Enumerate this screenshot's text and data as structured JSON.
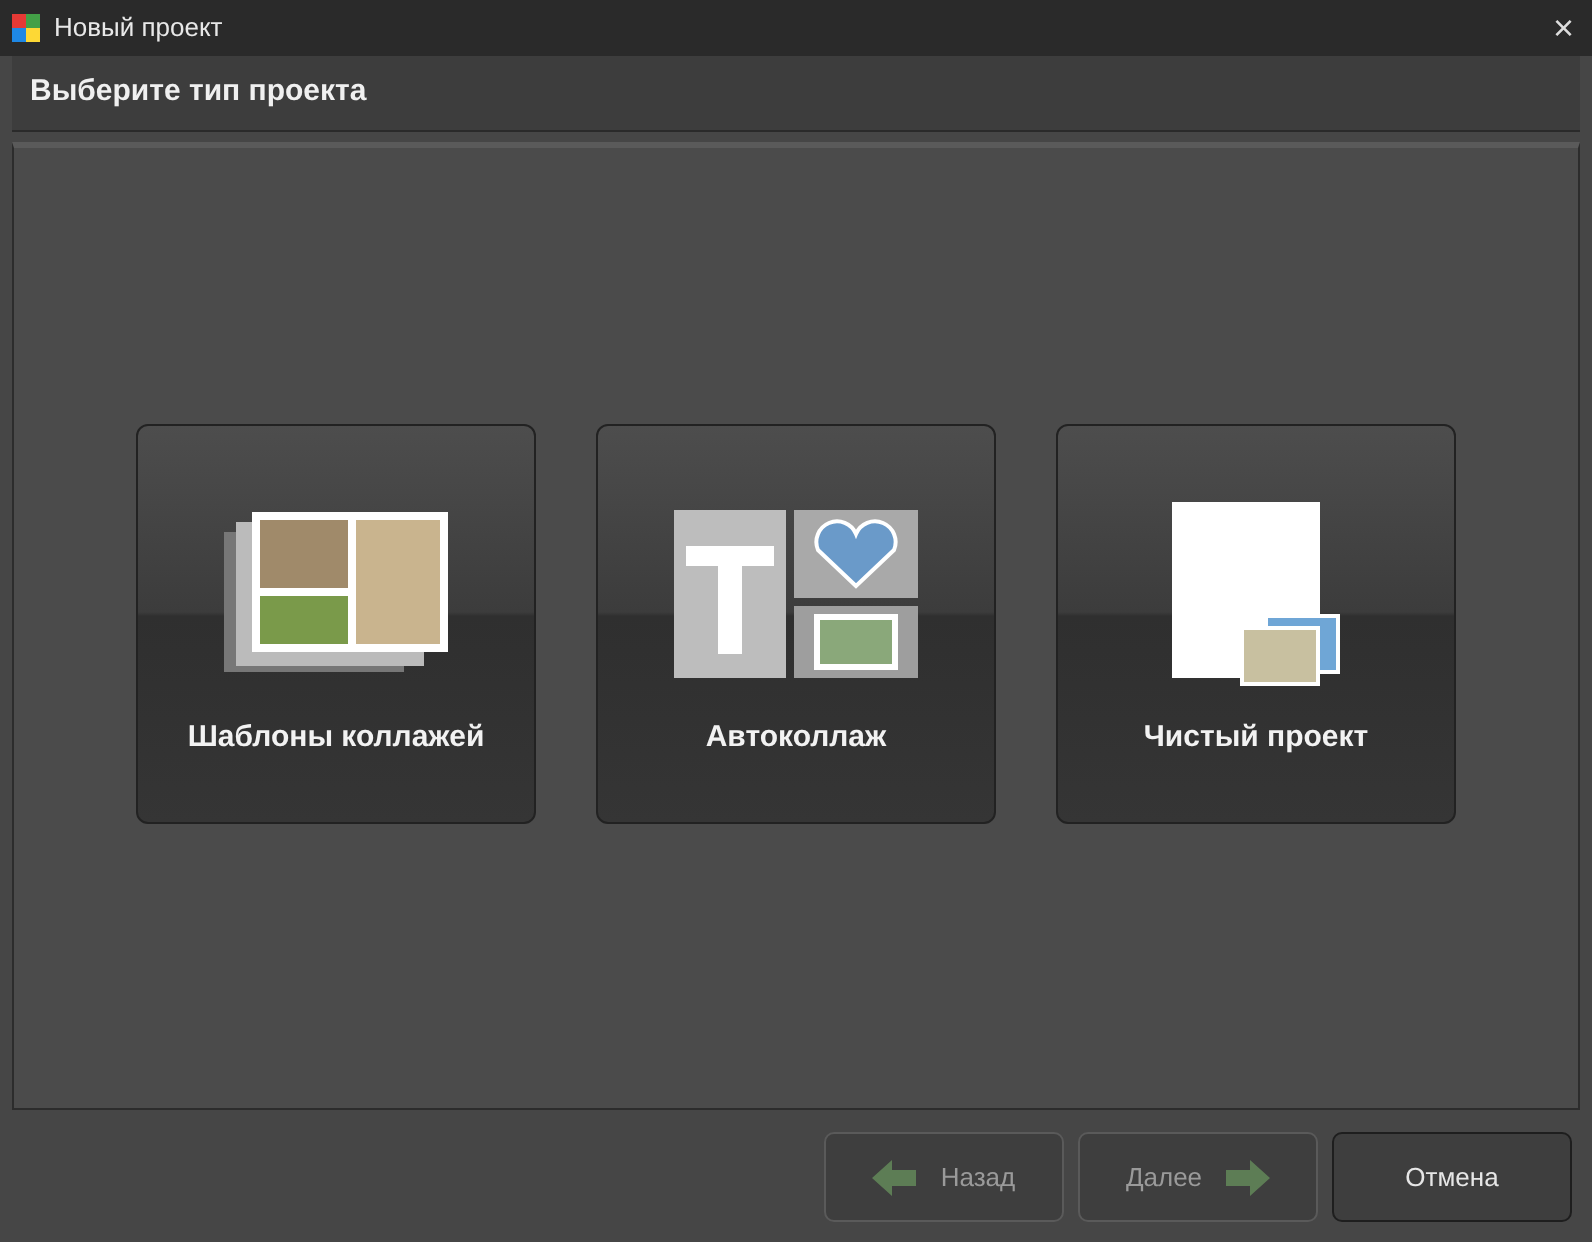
{
  "window": {
    "title": "Новый проект",
    "close": "×"
  },
  "header": {
    "title": "Выберите тип проекта"
  },
  "project_types": [
    {
      "kind": "templates",
      "label": "Шаблоны коллажей"
    },
    {
      "kind": "auto",
      "label": "Автоколлаж"
    },
    {
      "kind": "blank",
      "label": "Чистый проект"
    }
  ],
  "buttons": [
    {
      "kind": "back",
      "label": "Назад",
      "disabled": true
    },
    {
      "kind": "next",
      "label": "Далее",
      "disabled": true
    },
    {
      "kind": "cancel",
      "label": "Отмена",
      "disabled": false
    }
  ]
}
